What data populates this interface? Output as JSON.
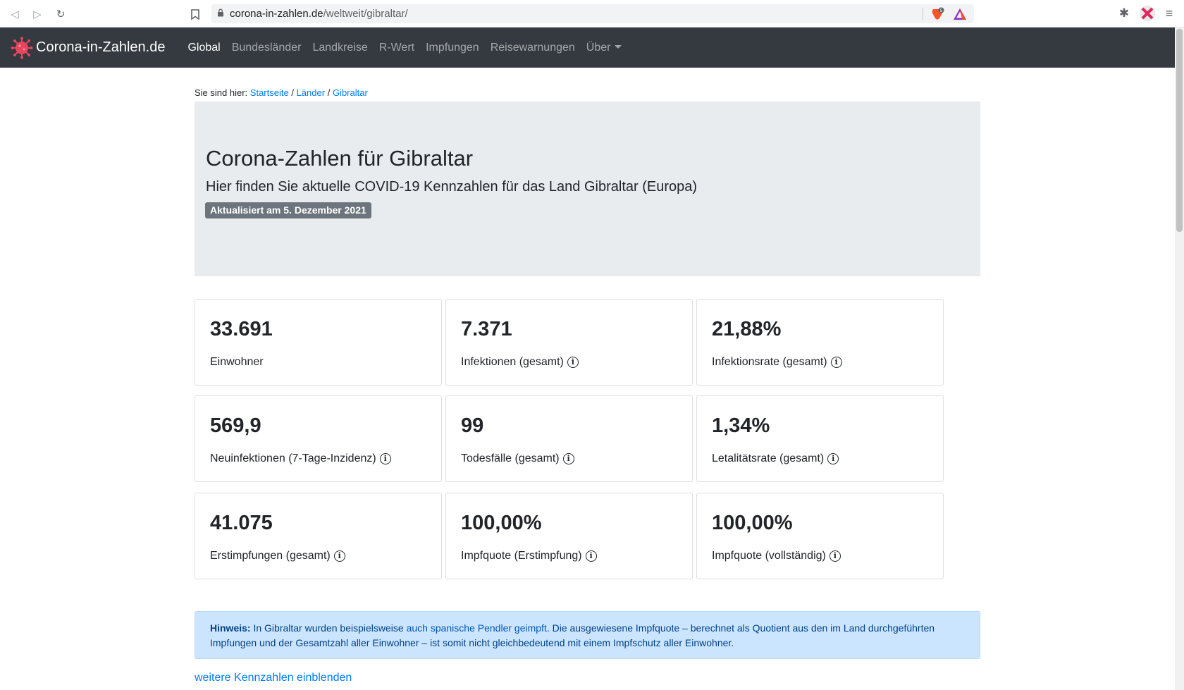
{
  "browser": {
    "url_host": "corona-in-zahlen.de",
    "url_path": "/weltweit/gibraltar/",
    "shield_count": "5"
  },
  "navbar": {
    "brand": "Corona-in-Zahlen.de",
    "links": [
      "Global",
      "Bundesländer",
      "Landkreise",
      "R-Wert",
      "Impfungen",
      "Reisewarnungen",
      "Über"
    ]
  },
  "breadcrumb": {
    "prefix": "Sie sind hier:",
    "items": [
      "Startseite",
      "Länder",
      "Gibraltar"
    ],
    "separator": "/"
  },
  "hero": {
    "title": "Corona-Zahlen für Gibraltar",
    "subtitle": "Hier finden Sie aktuelle COVID-19 Kennzahlen für das Land Gibraltar (Europa)",
    "badge": "Aktualisiert am 5. Dezember 2021"
  },
  "cards": [
    {
      "value": "33.691",
      "label": "Einwohner",
      "info": false
    },
    {
      "value": "7.371",
      "label": "Infektionen (gesamt)",
      "info": true
    },
    {
      "value": "21,88%",
      "label": "Infektionsrate (gesamt)",
      "info": true
    },
    {
      "value": "569,9",
      "label": "Neuinfektionen (7-Tage-Inzidenz)",
      "info": true
    },
    {
      "value": "99",
      "label": "Todesfälle (gesamt)",
      "info": true
    },
    {
      "value": "1,34%",
      "label": "Letalitätsrate (gesamt)",
      "info": true
    },
    {
      "value": "41.075",
      "label": "Erstimpfungen (gesamt)",
      "info": true
    },
    {
      "value": "100,00%",
      "label": "Impfquote (Erstimpfung)",
      "info": true
    },
    {
      "value": "100,00%",
      "label": "Impfquote (vollständig)",
      "info": true
    }
  ],
  "alert": {
    "strong": "Hinweis:",
    "text_before": " In Gibraltar wurden beispielsweise ",
    "link": "auch spanische Pendler geimpft",
    "text_after": ". Die ausgewiesene Impfquote – berechnet als Quotient aus den im Land durchgeführten Impfungen und der Gesamtzahl aller Einwohner – ist somit nicht gleichbedeutend mit einem Impfschutz aller Einwohner."
  },
  "more_link": "weitere Kennzahlen einblenden",
  "colors": {
    "navbar_bg": "#343a40",
    "link": "#007bff",
    "jumbotron_bg": "#e9ecef",
    "badge_bg": "#6c757d",
    "alert_bg": "#cce5ff"
  }
}
